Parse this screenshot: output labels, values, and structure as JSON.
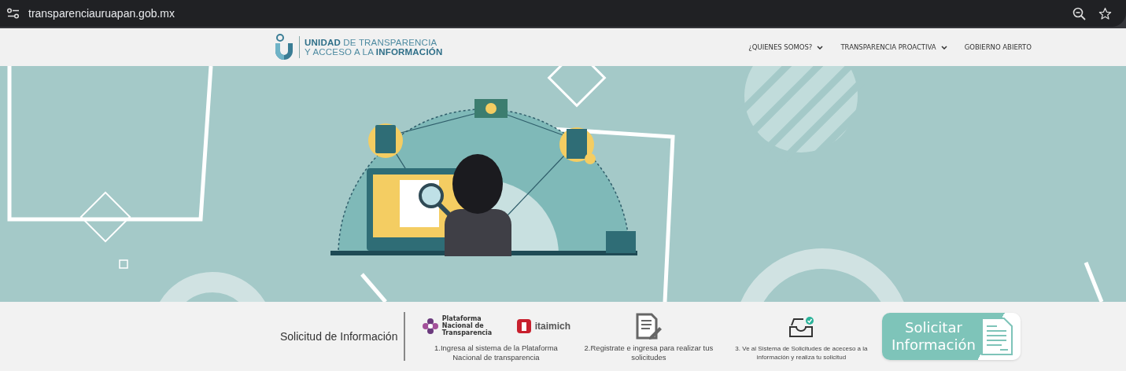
{
  "browser": {
    "url": "transparenciauruapan.gob.mx"
  },
  "header": {
    "logo": {
      "line1": "**UNIDAD** DE TRANSPARENCIA",
      "line2": "Y ACCESO A LA **INFORMACIÓN**"
    },
    "nav": [
      {
        "label": "¿QUIENES SOMOS?",
        "dropdown": true
      },
      {
        "label": "TRANSPARENCIA PROACTIVA",
        "dropdown": true
      },
      {
        "label": "GOBIERNO ABIERTO",
        "dropdown": false
      }
    ]
  },
  "request_bar": {
    "title": "Solicitud de Información",
    "steps": [
      {
        "kind": "logos",
        "logo_texts": [
          "Plataforma Nacional de Transparencia",
          "itai**mich**"
        ],
        "text": "1.Ingresa al sistema de la Plataforma Nacional de transparencia"
      },
      {
        "kind": "document",
        "text": "2.Registrate e ingresa para realizar tus solicitudes"
      },
      {
        "kind": "inbox",
        "text": "3. Ve al Sistema de Solicitudes de aceceso a la información y realiza tu solicitud"
      }
    ],
    "button": "Solicitar Información"
  }
}
